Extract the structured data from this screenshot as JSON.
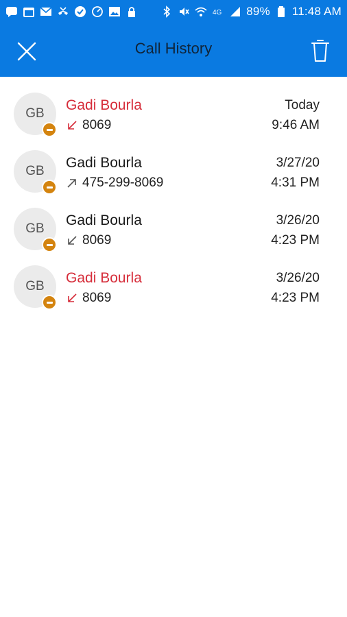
{
  "status_bar": {
    "battery_percent": "89%",
    "time": "11:48 AM",
    "network_label": "4G"
  },
  "header": {
    "title": "Call History",
    "close_icon": "close-icon",
    "delete_icon": "trash-icon",
    "background_color": "#0a7ae1"
  },
  "calls": [
    {
      "initials": "GB",
      "name": "Gadi Bourla",
      "direction": "incoming",
      "missed": true,
      "number": "8069",
      "date": "Today",
      "time": "9:46 AM"
    },
    {
      "initials": "GB",
      "name": "Gadi Bourla",
      "direction": "outgoing",
      "missed": false,
      "number": "475-299-8069",
      "date": "3/27/20",
      "time": "4:31 PM"
    },
    {
      "initials": "GB",
      "name": "Gadi Bourla",
      "direction": "incoming",
      "missed": false,
      "number": "8069",
      "date": "3/26/20",
      "time": "4:23 PM"
    },
    {
      "initials": "GB",
      "name": "Gadi Bourla",
      "direction": "incoming",
      "missed": true,
      "number": "8069",
      "date": "3/26/20",
      "time": "4:23 PM"
    }
  ],
  "colors": {
    "missed": "#d62d3a",
    "presence_away": "#d4840f"
  }
}
